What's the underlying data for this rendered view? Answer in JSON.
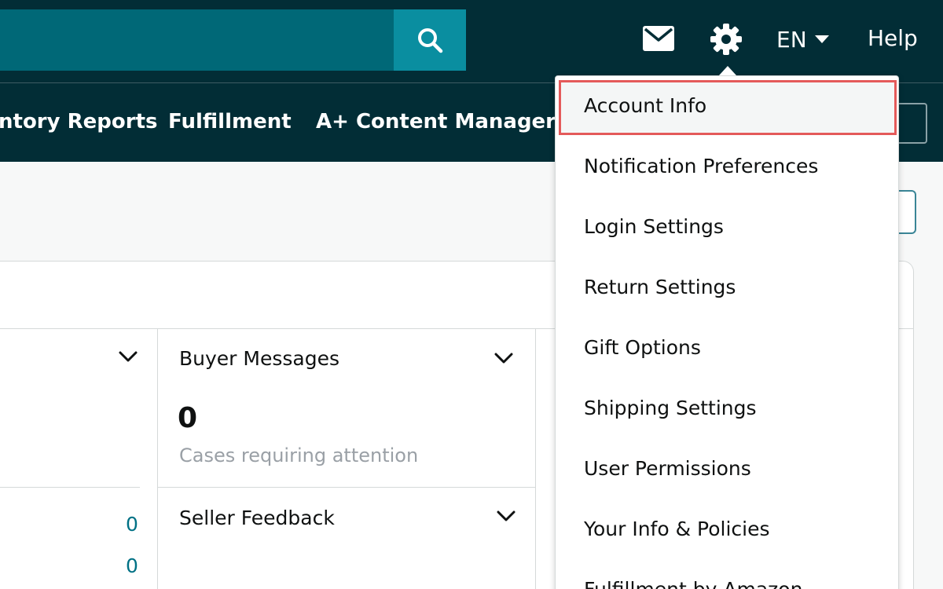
{
  "header": {
    "search": {
      "placeholder": "",
      "icon": "search-icon"
    },
    "icons": [
      "mail-icon",
      "gear-icon"
    ],
    "language": "EN",
    "help_label": "Help"
  },
  "nav": {
    "items": [
      "ntory Reports",
      "Fulfillment",
      "A+ Content Manager"
    ]
  },
  "cards": {
    "buyer_messages": {
      "title": "Buyer Messages",
      "count": "0",
      "subtitle": "Cases requiring attention"
    },
    "seller_feedback": {
      "title": "Seller Feedback"
    },
    "left_values": [
      "0",
      "0"
    ]
  },
  "settings_menu": {
    "selected": "Account Info",
    "items": [
      "Account Info",
      "Notification Preferences",
      "Login Settings",
      "Return Settings",
      "Gift Options",
      "Shipping Settings",
      "User Permissions",
      "Your Info & Policies",
      "Fulfillment by Amazon"
    ]
  },
  "colors": {
    "topbar": "#022d36",
    "search_field": "#006877",
    "search_button": "#0a8ea0",
    "highlight_border": "#e45a5a",
    "link": "#007185"
  }
}
